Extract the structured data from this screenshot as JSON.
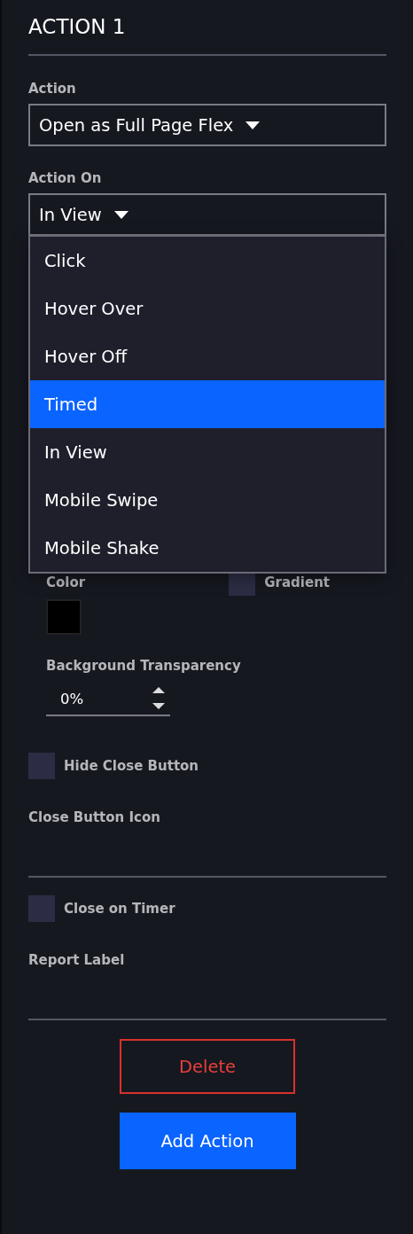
{
  "title": "ACTION 1",
  "action": {
    "label": "Action",
    "value": "Open as Full Page Flex"
  },
  "action_on": {
    "label": "Action On",
    "value": "In View",
    "expanded": true,
    "options": [
      {
        "label": "Click",
        "highlighted": false
      },
      {
        "label": "Hover Over",
        "highlighted": false
      },
      {
        "label": "Hover Off",
        "highlighted": false
      },
      {
        "label": "Timed",
        "highlighted": true
      },
      {
        "label": "In View",
        "highlighted": false
      },
      {
        "label": "Mobile Swipe",
        "highlighted": false
      },
      {
        "label": "Mobile Shake",
        "highlighted": false
      }
    ]
  },
  "background": {
    "color_label": "Color",
    "color": "#000000",
    "gradient": {
      "label": "Gradient",
      "checked": false
    },
    "transparency": {
      "label": "Background Transparency",
      "value": "0%"
    }
  },
  "hide_close_button": {
    "label": "Hide Close Button",
    "checked": false
  },
  "close_button_icon": {
    "label": "Close Button Icon"
  },
  "close_on_timer": {
    "label": "Close on Timer",
    "checked": false
  },
  "report_label": {
    "label": "Report Label"
  },
  "buttons": [
    {
      "kind": "delete",
      "label": "Delete"
    },
    {
      "kind": "primary",
      "label": "Add Action"
    }
  ]
}
